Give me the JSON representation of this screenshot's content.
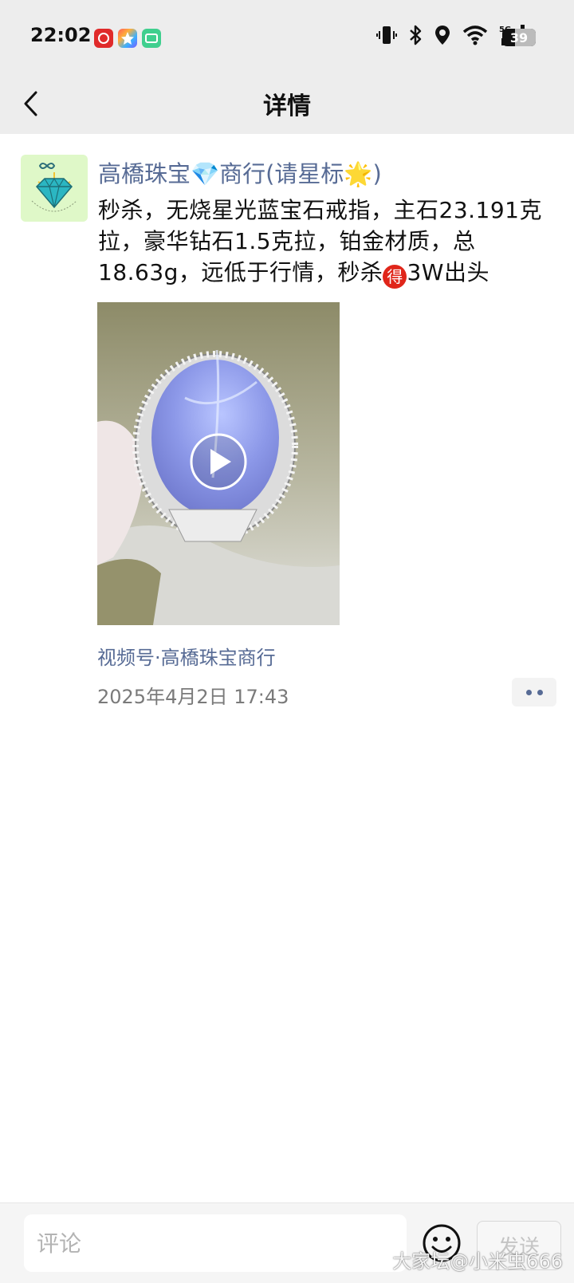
{
  "status_bar": {
    "time": "22:02",
    "battery": "39",
    "battery_level": 0.39,
    "app_icons": [
      "red-app-icon",
      "star-app-icon",
      "green-app-icon"
    ],
    "system_icons": [
      "vibrate-icon",
      "bluetooth-icon",
      "location-icon",
      "wifi-icon",
      "signal-5g-icon"
    ],
    "network": "5G"
  },
  "header": {
    "title": "详情",
    "back_icon": "chevron-left-icon"
  },
  "post": {
    "author": "高橋珠宝💎商行(请星标🌟)",
    "text_part1": "秒杀，无烧星光蓝宝石戒指，主石23.191克拉，豪华钻石1.5克拉，铂金材质，总18.63g，远低于行情，秒杀",
    "emoji_char": "得",
    "text_part2": "3W出头",
    "video": {
      "play_icon": "play-icon"
    },
    "channel_source": "视频号·高橋珠宝商行",
    "timestamp": "2025年4月2日 17:43"
  },
  "comment_bar": {
    "placeholder": "评论",
    "send_label": "发送",
    "emoji_icon": "smiley-icon"
  },
  "watermark": "大家坛@小米虫666",
  "colors": {
    "link": "#576b95",
    "header_bg": "#ededed",
    "emoji_red": "#e0261a"
  }
}
